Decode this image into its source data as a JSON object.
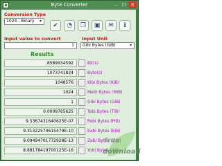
{
  "window": {
    "title": "Byte Converter",
    "controls": {
      "minimize": "–",
      "maximize": "☐",
      "close": "✕"
    }
  },
  "conversion": {
    "label": "Conversion Type",
    "selected": "1024 - Binary"
  },
  "toolbar": {
    "icons": [
      "check-icon",
      "clock-icon",
      "copy-icon",
      "save-icon",
      "email-icon",
      "info-icon"
    ]
  },
  "input": {
    "label": "Input value to convert",
    "value": "1"
  },
  "unit": {
    "label": "Input Unit",
    "selected": "Gibi Bytes (GiB)"
  },
  "results": {
    "title": "Results",
    "rows": [
      {
        "value": "8589934592",
        "unit": "Bit(s)"
      },
      {
        "value": "1073741824",
        "unit": "Byte(s)"
      },
      {
        "value": "1048576",
        "unit": "Kibi Bytes (KiB)"
      },
      {
        "value": "1024",
        "unit": "Mebi Bytes (MiB)"
      },
      {
        "value": "1",
        "unit": "Gibi Bytes (GiB)"
      },
      {
        "value": "0.0009765625",
        "unit": "Tebi Bytes (TiB)"
      },
      {
        "value": "9.5367431640625E-07",
        "unit": "Pebi Bytes (PiB)"
      },
      {
        "value": "9.31322574615479E-10",
        "unit": "Exbi Bytes (EiB)"
      },
      {
        "value": "9.09494701772928E-13",
        "unit": "Zebi Bytes (ZiB)"
      },
      {
        "value": "8.88178419700125E-16",
        "unit": "Yobi Bytes (YiB)"
      }
    ]
  },
  "watermark": {
    "line1": "free",
    "line2": "download"
  },
  "colors": {
    "frame": "#3b7a3f",
    "client_bg": "#dfeedd",
    "label_red": "#c81414",
    "results_green": "#2a8a2a",
    "unit_purple": "#a21ab2"
  }
}
